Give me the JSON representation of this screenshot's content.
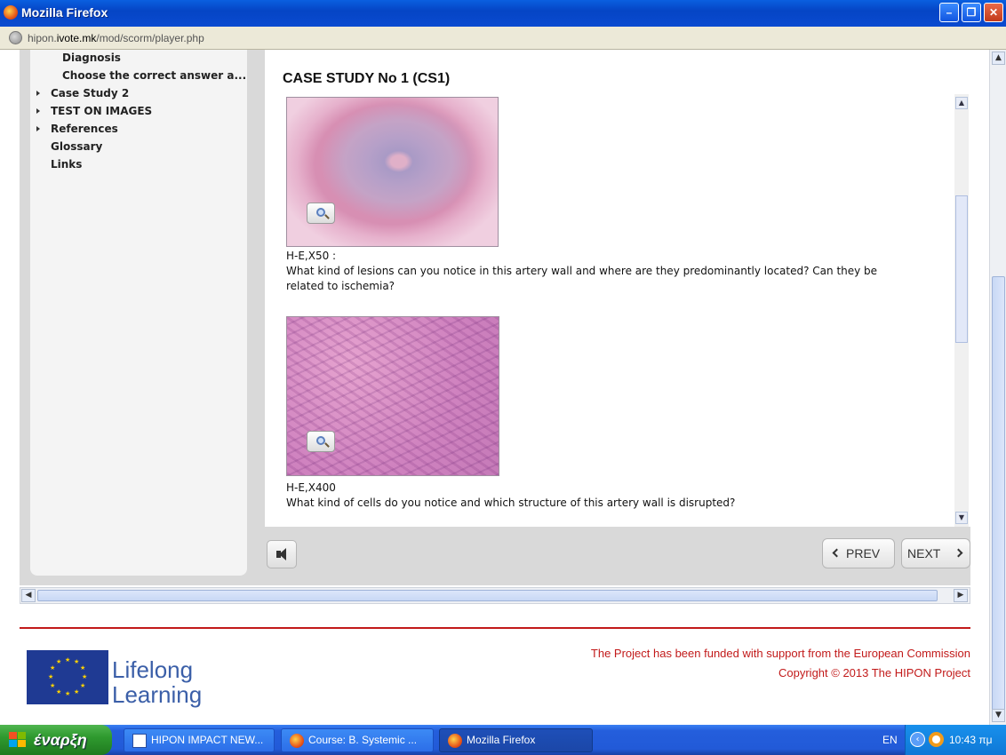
{
  "window": {
    "title": "Mozilla Firefox",
    "minimize": "–",
    "restore": "❐",
    "close": "✕"
  },
  "address": {
    "host_prefix": "hipon.",
    "host_main": "ivote.mk",
    "path": "/mod/scorm/player.php"
  },
  "toc": {
    "items": [
      {
        "label": "Diagnosis",
        "expandable": false
      },
      {
        "label": "Choose the correct answer a...",
        "expandable": false
      },
      {
        "label": "Case Study 2",
        "expandable": true
      },
      {
        "label": "TEST ON IMAGES",
        "expandable": true
      },
      {
        "label": "References",
        "expandable": true
      },
      {
        "label": "Glossary",
        "expandable": false
      },
      {
        "label": "Links",
        "expandable": false
      }
    ]
  },
  "content": {
    "heading": "CASE STUDY No 1 (CS1)",
    "figures": [
      {
        "label": "H-E,X50 :",
        "question": "What kind of lesions can you notice in this artery wall and where are they predominantly located? Can they be related to ischemia?"
      },
      {
        "label": "H-E,X400",
        "question": "What kind of cells do you notice and which structure of this artery wall is disrupted?"
      }
    ]
  },
  "controls": {
    "prev_label": "PREV",
    "next_label": "NEXT"
  },
  "footer": {
    "program_line1": "Lifelong",
    "program_line2": "Learning",
    "funding_text": "The Project has been funded with support from the European Commission",
    "copyright_text": "Copyright © 2013 The HIPON Project",
    "divider_color": "#c21a1a"
  },
  "taskbar": {
    "start_label": "έναρξη",
    "items": [
      {
        "label": "HIPON IMPACT NEW...",
        "icon": "word-document-icon",
        "active": false
      },
      {
        "label": "Course: B. Systemic ...",
        "icon": "firefox-icon",
        "active": false
      },
      {
        "label": "Mozilla Firefox",
        "icon": "firefox-icon",
        "active": true
      }
    ],
    "language": "EN",
    "clock": "10:43 πμ"
  }
}
